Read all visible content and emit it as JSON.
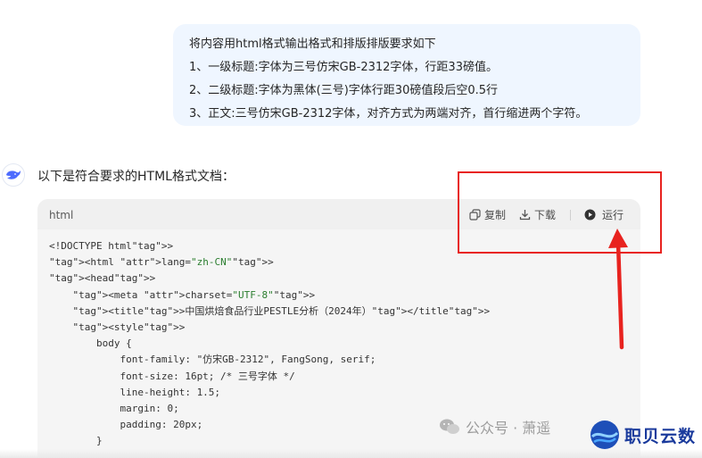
{
  "user_message": {
    "lines": [
      "将内容用html格式输出格式和排版排版要求如下",
      "1、一级标题:字体为三号仿宋GB-2312字体，行距33磅值。",
      "2、二级标题:字体为黑体(三号)字体行距30磅值段后空0.5行",
      "3、正文:三号仿宋GB-2312字体，对齐方式为两端对齐，首行缩进两个字符。"
    ]
  },
  "assistant": {
    "intro": "以下是符合要求的HTML格式文档："
  },
  "code_block": {
    "language": "html",
    "copy_label": "复制",
    "download_label": "下载",
    "run_label": "运行",
    "lines": [
      "<!DOCTYPE html>",
      "<html lang=\"zh-CN\">",
      "<head>",
      "    <meta charset=\"UTF-8\">",
      "    <title>中国烘焙食品行业PESTLE分析（2024年）</title>",
      "    <style>",
      "        body {",
      "            font-family: \"仿宋GB-2312\", FangSong, serif;",
      "            font-size: 16pt; /* 三号字体 */",
      "            line-height: 1.5;",
      "            margin: 0;",
      "            padding: 20px;",
      "        }"
    ]
  },
  "watermark": {
    "text": "公众号 · 萧遥",
    "brand": "职贝云数"
  },
  "colors": {
    "annotation": "#e8231f",
    "user_bubble": "#eff6ff",
    "code_bg": "#f5f5f5"
  }
}
